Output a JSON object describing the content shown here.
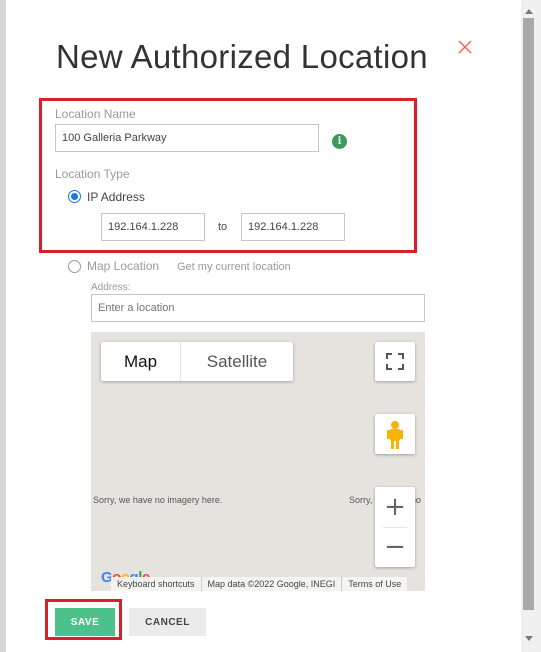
{
  "dialog": {
    "title": "New Authorized Location"
  },
  "form": {
    "location_name_label": "Location Name",
    "location_name_value": "100 Galleria Parkway",
    "info_icon_glyph": "i",
    "location_type_label": "Location Type",
    "ip_option_label": "IP Address",
    "ip_from_value": "192.164.1.228",
    "ip_to_label": "to",
    "ip_to_value": "192.164.1.228",
    "map_option_label": "Map Location",
    "get_location_link": "Get my current location",
    "address_label": "Address:",
    "address_placeholder": "Enter a location"
  },
  "map": {
    "tab_map": "Map",
    "tab_satellite": "Satellite",
    "no_imagery_left": "Sorry, we have no imagery here.",
    "no_imagery_right": "Sorry, we have no",
    "zoom_in": "+",
    "zoom_out": "−",
    "footer": [
      "Keyboard shortcuts",
      "Map data ©2022 Google, INEGI",
      "Terms of Use"
    ],
    "logo_text": "Google"
  },
  "buttons": {
    "save_label": "SAVE",
    "cancel_label": "CANCEL"
  },
  "colors": {
    "highlight": "#d9202a",
    "save_bg": "#4cc28a",
    "radio_accent": "#1a73e8",
    "info_icon": "#3e9a5a",
    "close_x": "#e8685a"
  }
}
